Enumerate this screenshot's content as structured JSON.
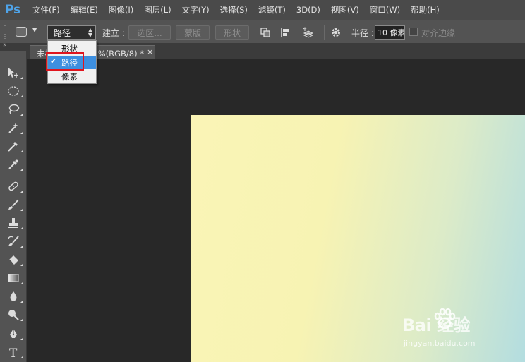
{
  "app": {
    "logo": "Ps"
  },
  "menu": [
    "文件(F)",
    "编辑(E)",
    "图像(I)",
    "图层(L)",
    "文字(Y)",
    "选择(S)",
    "滤镜(T)",
    "3D(D)",
    "视图(V)",
    "窗口(W)",
    "帮助(H)"
  ],
  "options": {
    "mode_value": "路径",
    "make_label": "建立 :",
    "selection_button": "选区...",
    "mask_button": "蒙版",
    "shape_button": "形状",
    "radius_label": "半径 :",
    "radius_value": "10 像素",
    "align_edges_label": "对齐边缘",
    "align_edges_checked": false
  },
  "dropdown": {
    "items": [
      "形状",
      "路径",
      "像素"
    ],
    "selected": "路径",
    "highlight_color": "#3d8fe0",
    "annotation_color": "#e0151e"
  },
  "document": {
    "tab_title": "未标题-1 @ 100%(RGB/8) *",
    "close": "×"
  },
  "tools": [
    "move-tool",
    "elliptical-marquee-tool",
    "lasso-tool",
    "magic-wand-tool",
    "crop-tool",
    "eyedropper-tool",
    "spot-healing-brush-tool",
    "brush-tool",
    "clone-stamp-tool",
    "history-brush-tool",
    "eraser-tool",
    "gradient-tool",
    "blur-tool",
    "dodge-tool",
    "pen-tool",
    "type-tool"
  ],
  "watermark": {
    "brand": "Bai  经验",
    "url": "jingyan.baidu.com"
  },
  "colors": {
    "ps_blue": "#4fa3e8",
    "canvas_left": "#faf4b6",
    "canvas_right": "#b3dde0"
  }
}
